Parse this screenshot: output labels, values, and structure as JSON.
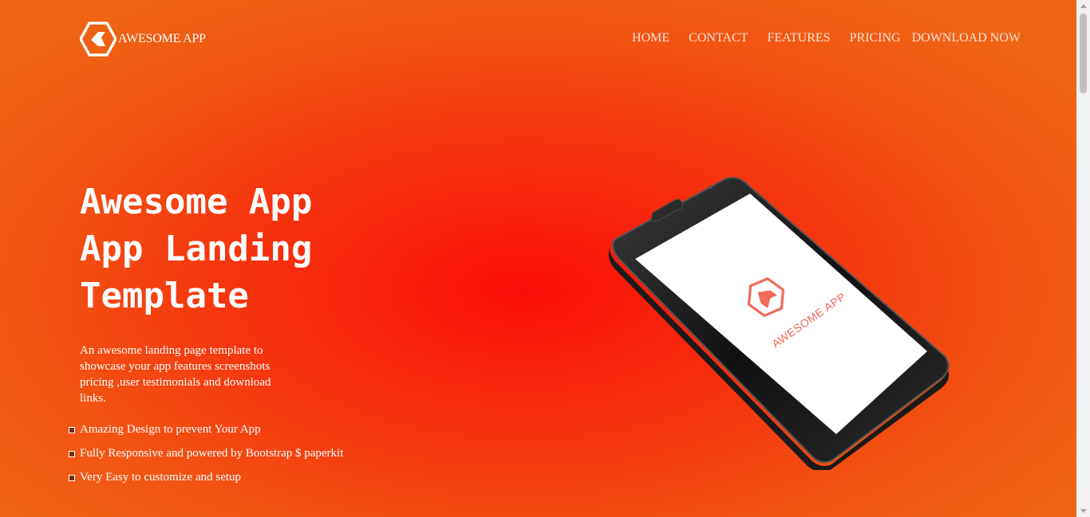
{
  "brand": {
    "name": "AWESOME APP",
    "icon": "hexagon-logo-icon"
  },
  "nav": {
    "items": [
      "HOME",
      "CONTACT",
      "FEATURES",
      "PRICING",
      "DOWNLOAD NOW"
    ]
  },
  "hero": {
    "title_lines": [
      "Awesome App",
      "App Landing",
      "Template"
    ],
    "description": "An awesome landing page template to showcase your app features screenshots pricing ,user testimonials and download links.",
    "features": [
      "Amazing Design to prevent Your App",
      "Fully Responsive and powered by Bootstrap $ paperkit",
      "Very Easy to customize and setup"
    ]
  },
  "phone": {
    "screen_text": "AWESOME APP",
    "icon": "phone-mockup-icon"
  },
  "colors": {
    "accent": "#f53a0f",
    "gradient_center": "#fb0d08",
    "gradient_edge": "#ef6414",
    "text": "#ffffff"
  }
}
